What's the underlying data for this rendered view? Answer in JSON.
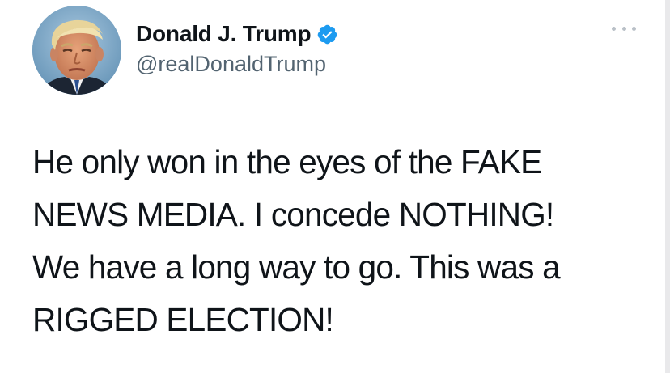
{
  "author": {
    "display_name": "Donald J. Trump",
    "handle": "@realDonaldTrump",
    "verified": true,
    "avatar_icon": "profile-photo"
  },
  "more_icon": "ellipsis-icon",
  "tweet": {
    "lines": [
      "He only won in the eyes of the FAKE",
      "NEWS MEDIA. I concede NOTHING!",
      "We have a long way to go. This was a",
      "RIGGED ELECTION!"
    ]
  },
  "colors": {
    "text": "#0f1419",
    "handle": "#536471",
    "verified_badge": "#1d9bf0",
    "background": "#ffffff"
  }
}
